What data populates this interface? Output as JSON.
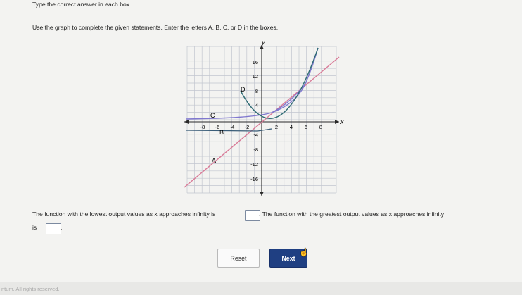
{
  "instruction": "Type the correct answer in each box.",
  "prompt": "Use the graph to complete the given statements. Enter the letters A, B, C, or D in the boxes.",
  "graph": {
    "x_axis_label": "x",
    "y_axis_label": "y",
    "x_tick_labels": [
      "-8",
      "-6",
      "-4",
      "-2",
      "2",
      "4",
      "6",
      "8"
    ],
    "y_tick_labels": [
      "16",
      "12",
      "8",
      "4",
      "-4",
      "-8",
      "-12",
      "-16"
    ],
    "curve_labels": [
      "A",
      "B",
      "C",
      "D"
    ],
    "colors": {
      "grid": "#c2c6cf",
      "axis": "#2a2a2a",
      "pink_line": "#d97b98",
      "purple_line": "#8078cf",
      "parabola": "#2f6b74"
    }
  },
  "statement1_before": "The function with the lowest output values as x approaches infinity is",
  "statement1_after": ". The function with the greatest output values as x approaches infinity",
  "statement2_before": "is",
  "statement2_after": ".",
  "answer1": "",
  "answer2": "",
  "buttons": {
    "reset": "Reset",
    "next": "Next"
  },
  "footer": "ntum. All rights reserved."
}
